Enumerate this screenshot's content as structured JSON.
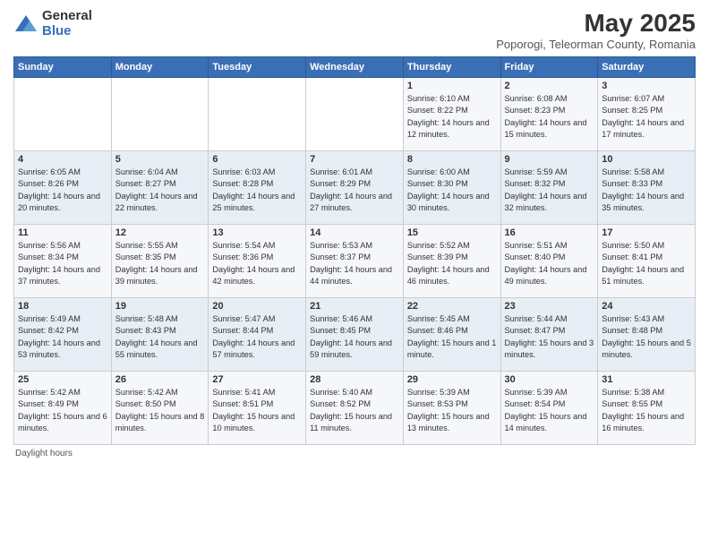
{
  "header": {
    "logo_general": "General",
    "logo_blue": "Blue",
    "title": "May 2025",
    "subtitle": "Poporogi, Teleorman County, Romania"
  },
  "columns": [
    "Sunday",
    "Monday",
    "Tuesday",
    "Wednesday",
    "Thursday",
    "Friday",
    "Saturday"
  ],
  "weeks": [
    [
      {
        "day": "",
        "sunrise": "",
        "sunset": "",
        "daylight": ""
      },
      {
        "day": "",
        "sunrise": "",
        "sunset": "",
        "daylight": ""
      },
      {
        "day": "",
        "sunrise": "",
        "sunset": "",
        "daylight": ""
      },
      {
        "day": "",
        "sunrise": "",
        "sunset": "",
        "daylight": ""
      },
      {
        "day": "1",
        "sunrise": "Sunrise: 6:10 AM",
        "sunset": "Sunset: 8:22 PM",
        "daylight": "Daylight: 14 hours and 12 minutes."
      },
      {
        "day": "2",
        "sunrise": "Sunrise: 6:08 AM",
        "sunset": "Sunset: 8:23 PM",
        "daylight": "Daylight: 14 hours and 15 minutes."
      },
      {
        "day": "3",
        "sunrise": "Sunrise: 6:07 AM",
        "sunset": "Sunset: 8:25 PM",
        "daylight": "Daylight: 14 hours and 17 minutes."
      }
    ],
    [
      {
        "day": "4",
        "sunrise": "Sunrise: 6:05 AM",
        "sunset": "Sunset: 8:26 PM",
        "daylight": "Daylight: 14 hours and 20 minutes."
      },
      {
        "day": "5",
        "sunrise": "Sunrise: 6:04 AM",
        "sunset": "Sunset: 8:27 PM",
        "daylight": "Daylight: 14 hours and 22 minutes."
      },
      {
        "day": "6",
        "sunrise": "Sunrise: 6:03 AM",
        "sunset": "Sunset: 8:28 PM",
        "daylight": "Daylight: 14 hours and 25 minutes."
      },
      {
        "day": "7",
        "sunrise": "Sunrise: 6:01 AM",
        "sunset": "Sunset: 8:29 PM",
        "daylight": "Daylight: 14 hours and 27 minutes."
      },
      {
        "day": "8",
        "sunrise": "Sunrise: 6:00 AM",
        "sunset": "Sunset: 8:30 PM",
        "daylight": "Daylight: 14 hours and 30 minutes."
      },
      {
        "day": "9",
        "sunrise": "Sunrise: 5:59 AM",
        "sunset": "Sunset: 8:32 PM",
        "daylight": "Daylight: 14 hours and 32 minutes."
      },
      {
        "day": "10",
        "sunrise": "Sunrise: 5:58 AM",
        "sunset": "Sunset: 8:33 PM",
        "daylight": "Daylight: 14 hours and 35 minutes."
      }
    ],
    [
      {
        "day": "11",
        "sunrise": "Sunrise: 5:56 AM",
        "sunset": "Sunset: 8:34 PM",
        "daylight": "Daylight: 14 hours and 37 minutes."
      },
      {
        "day": "12",
        "sunrise": "Sunrise: 5:55 AM",
        "sunset": "Sunset: 8:35 PM",
        "daylight": "Daylight: 14 hours and 39 minutes."
      },
      {
        "day": "13",
        "sunrise": "Sunrise: 5:54 AM",
        "sunset": "Sunset: 8:36 PM",
        "daylight": "Daylight: 14 hours and 42 minutes."
      },
      {
        "day": "14",
        "sunrise": "Sunrise: 5:53 AM",
        "sunset": "Sunset: 8:37 PM",
        "daylight": "Daylight: 14 hours and 44 minutes."
      },
      {
        "day": "15",
        "sunrise": "Sunrise: 5:52 AM",
        "sunset": "Sunset: 8:39 PM",
        "daylight": "Daylight: 14 hours and 46 minutes."
      },
      {
        "day": "16",
        "sunrise": "Sunrise: 5:51 AM",
        "sunset": "Sunset: 8:40 PM",
        "daylight": "Daylight: 14 hours and 49 minutes."
      },
      {
        "day": "17",
        "sunrise": "Sunrise: 5:50 AM",
        "sunset": "Sunset: 8:41 PM",
        "daylight": "Daylight: 14 hours and 51 minutes."
      }
    ],
    [
      {
        "day": "18",
        "sunrise": "Sunrise: 5:49 AM",
        "sunset": "Sunset: 8:42 PM",
        "daylight": "Daylight: 14 hours and 53 minutes."
      },
      {
        "day": "19",
        "sunrise": "Sunrise: 5:48 AM",
        "sunset": "Sunset: 8:43 PM",
        "daylight": "Daylight: 14 hours and 55 minutes."
      },
      {
        "day": "20",
        "sunrise": "Sunrise: 5:47 AM",
        "sunset": "Sunset: 8:44 PM",
        "daylight": "Daylight: 14 hours and 57 minutes."
      },
      {
        "day": "21",
        "sunrise": "Sunrise: 5:46 AM",
        "sunset": "Sunset: 8:45 PM",
        "daylight": "Daylight: 14 hours and 59 minutes."
      },
      {
        "day": "22",
        "sunrise": "Sunrise: 5:45 AM",
        "sunset": "Sunset: 8:46 PM",
        "daylight": "Daylight: 15 hours and 1 minute."
      },
      {
        "day": "23",
        "sunrise": "Sunrise: 5:44 AM",
        "sunset": "Sunset: 8:47 PM",
        "daylight": "Daylight: 15 hours and 3 minutes."
      },
      {
        "day": "24",
        "sunrise": "Sunrise: 5:43 AM",
        "sunset": "Sunset: 8:48 PM",
        "daylight": "Daylight: 15 hours and 5 minutes."
      }
    ],
    [
      {
        "day": "25",
        "sunrise": "Sunrise: 5:42 AM",
        "sunset": "Sunset: 8:49 PM",
        "daylight": "Daylight: 15 hours and 6 minutes."
      },
      {
        "day": "26",
        "sunrise": "Sunrise: 5:42 AM",
        "sunset": "Sunset: 8:50 PM",
        "daylight": "Daylight: 15 hours and 8 minutes."
      },
      {
        "day": "27",
        "sunrise": "Sunrise: 5:41 AM",
        "sunset": "Sunset: 8:51 PM",
        "daylight": "Daylight: 15 hours and 10 minutes."
      },
      {
        "day": "28",
        "sunrise": "Sunrise: 5:40 AM",
        "sunset": "Sunset: 8:52 PM",
        "daylight": "Daylight: 15 hours and 11 minutes."
      },
      {
        "day": "29",
        "sunrise": "Sunrise: 5:39 AM",
        "sunset": "Sunset: 8:53 PM",
        "daylight": "Daylight: 15 hours and 13 minutes."
      },
      {
        "day": "30",
        "sunrise": "Sunrise: 5:39 AM",
        "sunset": "Sunset: 8:54 PM",
        "daylight": "Daylight: 15 hours and 14 minutes."
      },
      {
        "day": "31",
        "sunrise": "Sunrise: 5:38 AM",
        "sunset": "Sunset: 8:55 PM",
        "daylight": "Daylight: 15 hours and 16 minutes."
      }
    ]
  ],
  "footer": "Daylight hours"
}
